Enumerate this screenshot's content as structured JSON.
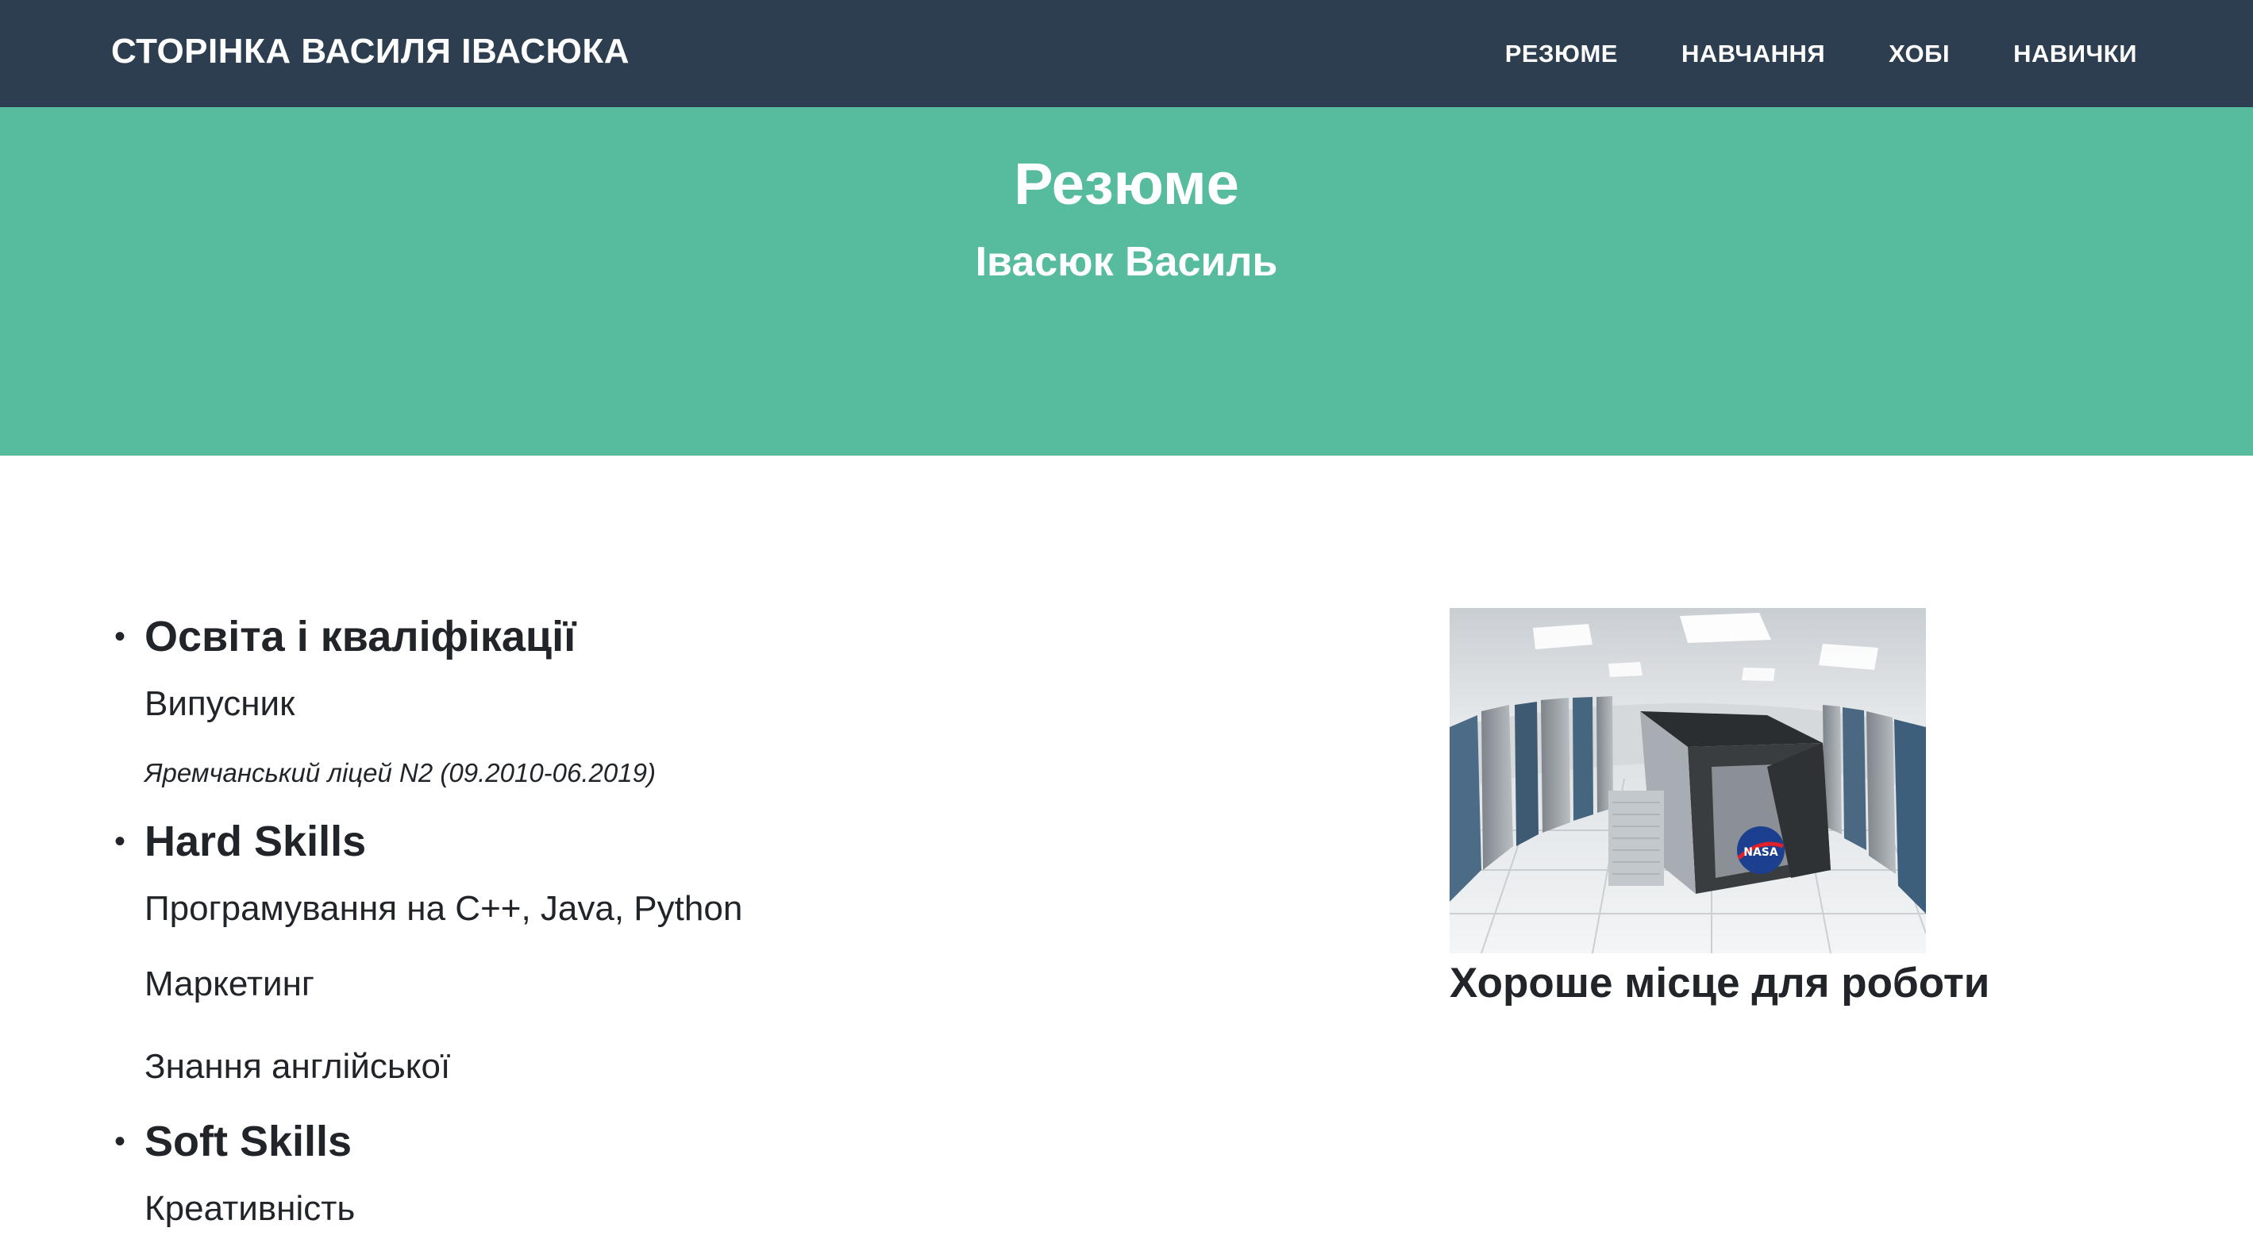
{
  "nav": {
    "brand": "СТОРІНКА ВАСИЛЯ ІВАСЮКА",
    "links": [
      "РЕЗЮМЕ",
      "НАВЧАННЯ",
      "ХОБІ",
      "НАВИЧКИ"
    ]
  },
  "masthead": {
    "title": "Резюме",
    "subtitle": "Івасюк Василь"
  },
  "resume": {
    "sections": [
      {
        "title": "Освіта і кваліфікації",
        "items": [
          "Випусник"
        ],
        "note": "Яремчанський ліцей N2 (09.2010-06.2019)"
      },
      {
        "title": "Hard Skills",
        "items": [
          "Програмування на C++, Java, Python",
          "Маркетинг",
          "Знання англійської"
        ]
      },
      {
        "title": "Soft Skills",
        "items": [
          "Креативність"
        ]
      }
    ]
  },
  "feature": {
    "caption": "Хороше місце для роботи",
    "logo_text": "NASA"
  },
  "colors": {
    "navbar": "#2c3e50",
    "masthead": "#57bb9e",
    "text": "#212529"
  }
}
